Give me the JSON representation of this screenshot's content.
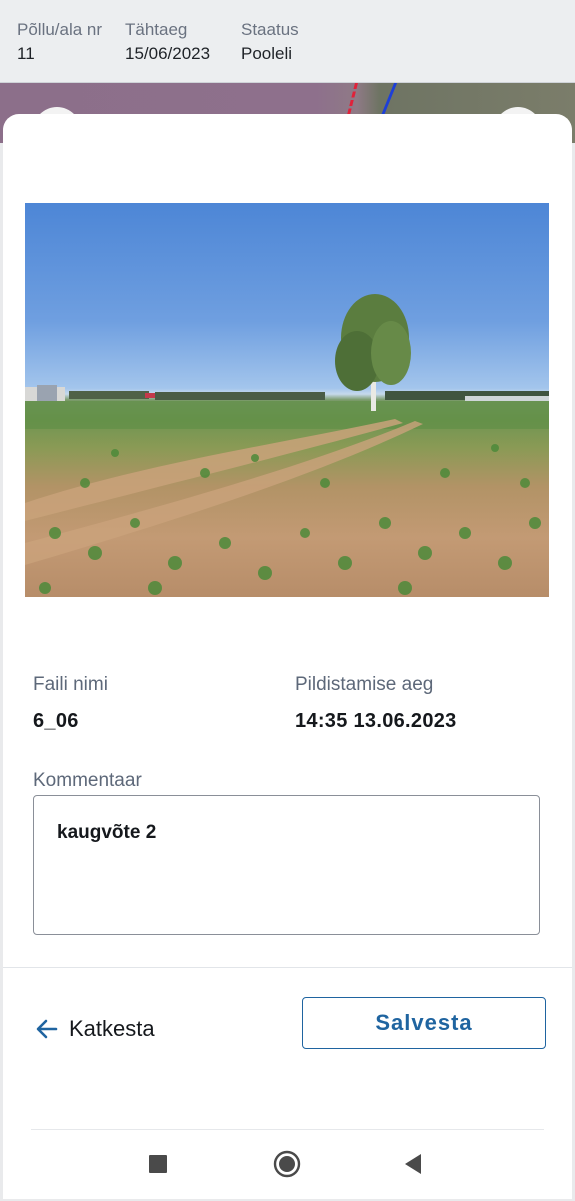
{
  "header": {
    "field_label": "Põllu/ala nr",
    "field_value": "11",
    "deadline_label": "Tähtaeg",
    "deadline_value": "15/06/2023",
    "status_label": "Staatus",
    "status_value": "Pooleli"
  },
  "photo": {
    "file_name_label": "Faili nimi",
    "file_name_value": "6_06",
    "taken_label": "Pildistamise aeg",
    "taken_value": "14:35 13.06.2023"
  },
  "comment": {
    "label": "Kommentaar",
    "value": "kaugvõte 2"
  },
  "actions": {
    "cancel_label": "Katkesta",
    "save_label": "Salvesta"
  },
  "colors": {
    "accent": "#1f64a0",
    "text": "#15181c",
    "muted": "#5d6879"
  },
  "navbar": {
    "icons": [
      "recents-square-icon",
      "home-circle-icon",
      "back-triangle-icon"
    ]
  }
}
